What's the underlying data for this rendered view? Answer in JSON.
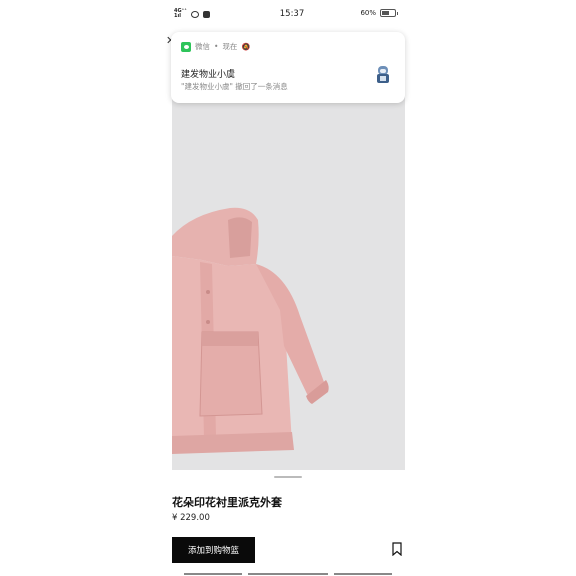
{
  "status_bar": {
    "signal_text": "4G⁺⁺ 1ıl",
    "time": "15:37",
    "battery": "60%",
    "battery_level": 0.6
  },
  "notification": {
    "app_name": "微信",
    "separator": "•",
    "time": "现在",
    "title": "建发物业小虞",
    "body": "\"建发物业小虞\" 撤回了一条消息"
  },
  "product": {
    "title": "花朵印花衬里派克外套",
    "price": "¥ 229.00",
    "add_to_cart_label": "添加到购物篮",
    "image_color": "#e3e3e4",
    "coat_color": "#e9b7b4"
  },
  "icons": {
    "back": "close-icon",
    "bookmark": "bookmark-icon",
    "bell": "bell-icon",
    "wechat": "wechat-icon"
  }
}
